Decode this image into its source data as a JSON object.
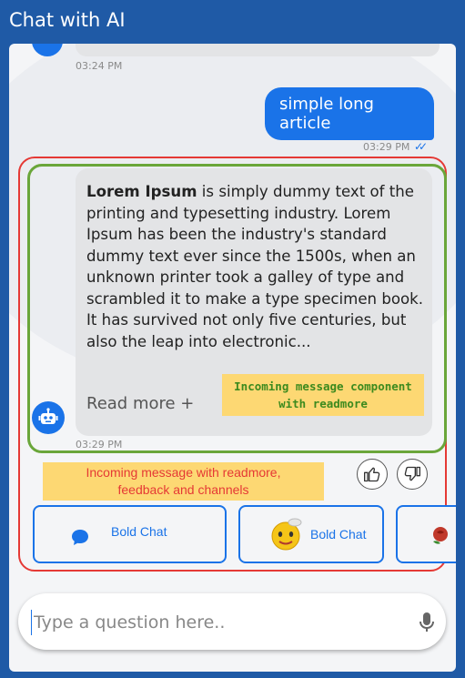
{
  "app": {
    "title": "Chat with AI"
  },
  "messages": {
    "prev_time": "03:24 PM",
    "outgoing_text": "simple long article",
    "outgoing_time": "03:29 PM",
    "incoming_bold": "Lorem Ipsum",
    "incoming_text": " is simply dummy text of the printing and typesetting industry. Lorem Ipsum has been the industry's standard dummy text ever since the 1500s, when an unknown printer took a galley of type and scrambled it to make a type specimen book. It has survived not only five centuries, but also the leap into electronic...",
    "read_more": "Read more +",
    "incoming_time": "03:29 PM"
  },
  "annotations": {
    "green_note_line1": "Incoming message component",
    "green_note_line2": "with readmore",
    "red_note_line1": "Incoming message with readmore,",
    "red_note_line2": "feedback and channels"
  },
  "channels": [
    {
      "label": "Bold Chat",
      "icon": "speech-bubble-icon"
    },
    {
      "label": "Bold Chat",
      "icon": "emoji-face-icon"
    }
  ],
  "composer": {
    "placeholder": "Type a question here.."
  },
  "colors": {
    "primary": "#1a73e8",
    "header": "#1f5aa6",
    "annotation_bg": "#fdd873",
    "red_outline": "#e53935",
    "green_outline": "#6aa63a"
  }
}
